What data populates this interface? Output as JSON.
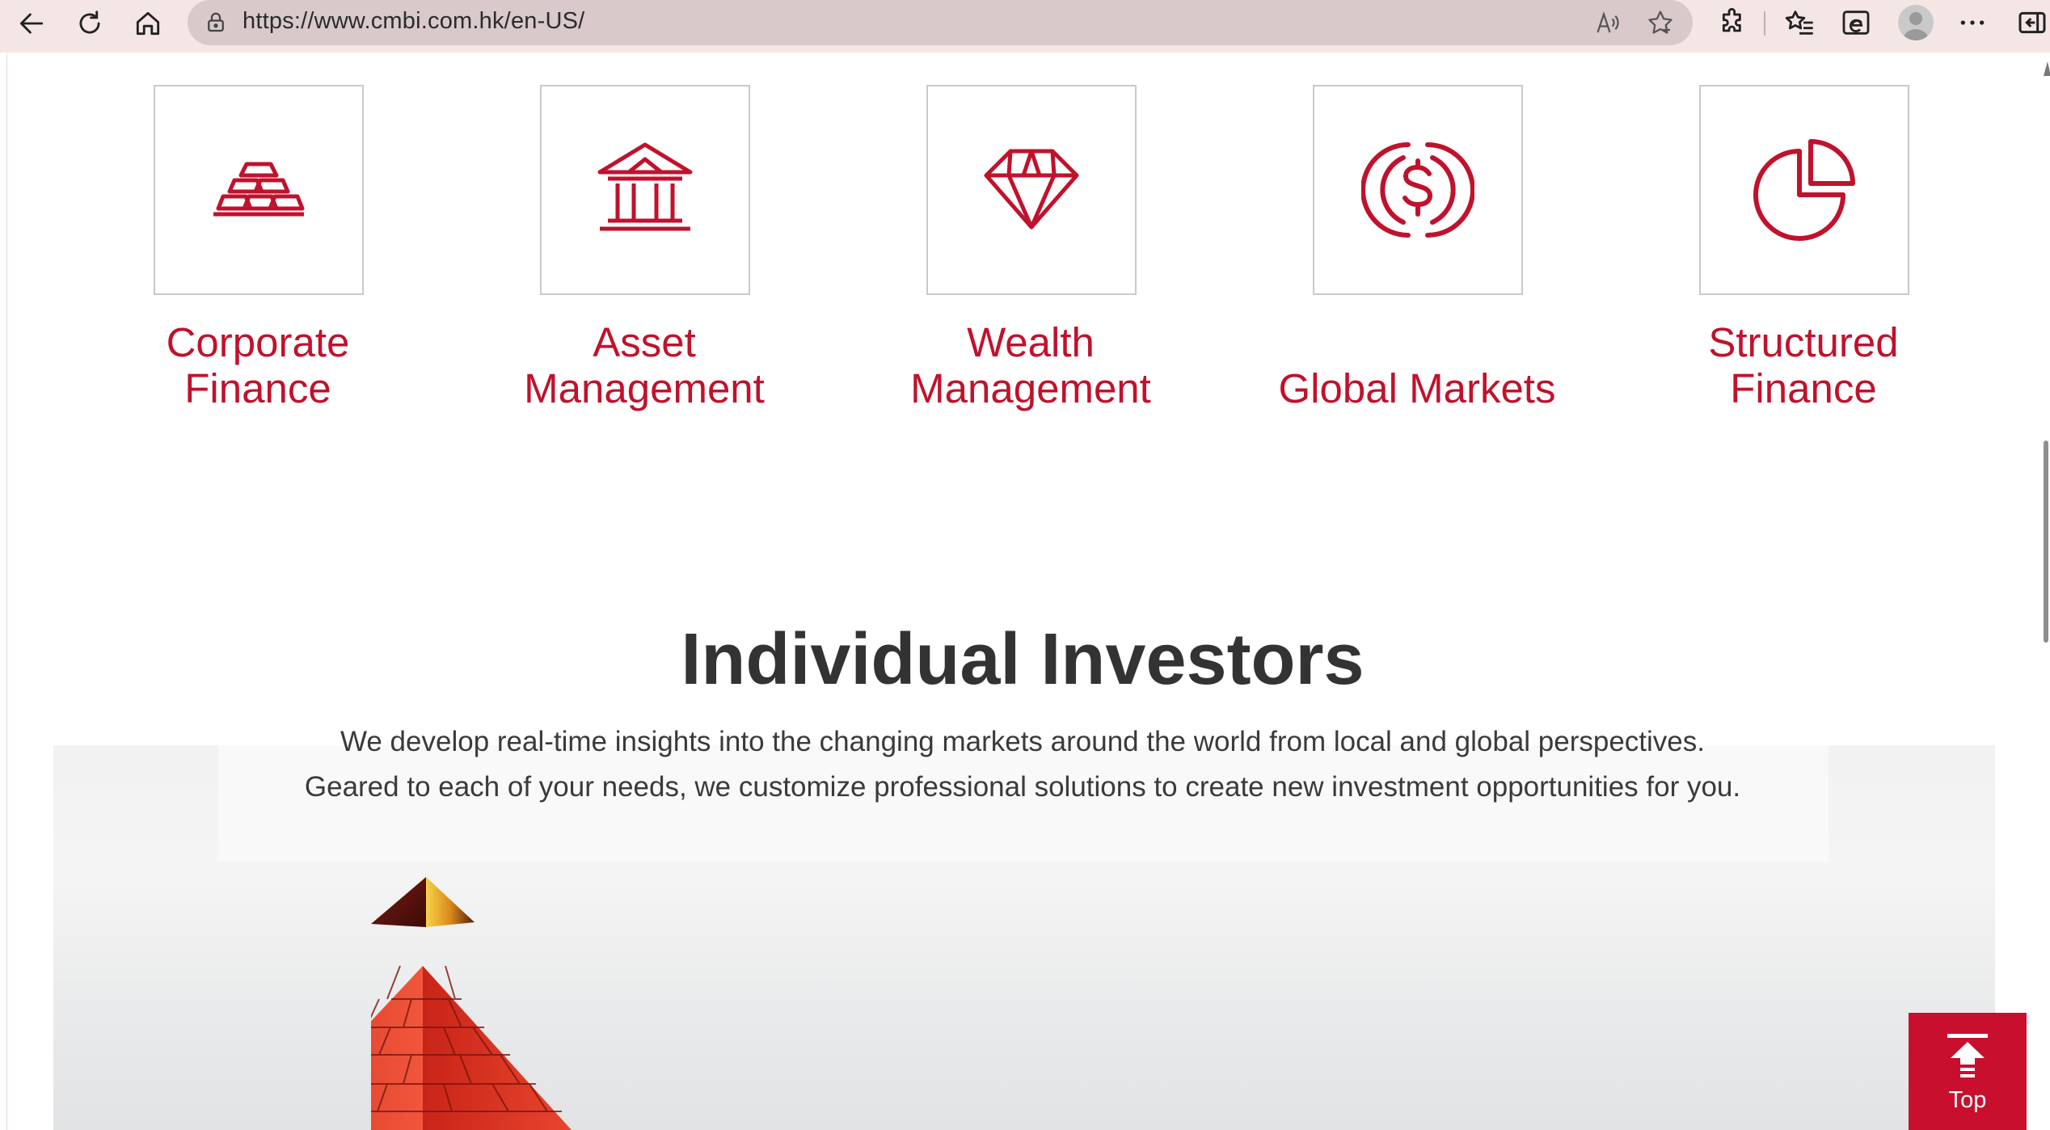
{
  "browser": {
    "url": "https://www.cmbi.com.hk/en-US/",
    "icons": {
      "back": "back-arrow-icon",
      "refresh": "refresh-icon",
      "home": "home-icon",
      "lock": "lock-icon",
      "read_aloud": "read-aloud-icon",
      "favorite": "star-icon",
      "extensions": "puzzle-icon",
      "favorites_bar": "favorites-icon",
      "ie_mode": "ie-mode-icon",
      "profile": "avatar",
      "more": "ellipsis-icon",
      "sidebar": "sidebar-icon"
    }
  },
  "services": [
    {
      "label": "Corporate Finance",
      "icon": "gold-bars-icon"
    },
    {
      "label": "Asset Management",
      "icon": "bank-building-icon"
    },
    {
      "label": "Wealth Management",
      "icon": "diamond-icon"
    },
    {
      "label": "Global Markets",
      "icon": "dollar-circle-icon"
    },
    {
      "label": "Structured Finance",
      "icon": "pie-chart-icon"
    }
  ],
  "individual_investors": {
    "title": "Individual Investors",
    "line1": "We develop real-time insights into the changing markets around the world from local and global perspectives.",
    "line2": "Geared to each of your needs, we customize professional solutions to create new investment opportunities for you."
  },
  "back_to_top": {
    "label": "Top",
    "icon": "arrow-up-to-line-icon"
  },
  "colors": {
    "brand_red": "#c0122c",
    "top_button": "#c8102e",
    "title_text": "#333333",
    "chrome_bg": "#f5e6e6",
    "address_bar": "#d9c9cb"
  }
}
